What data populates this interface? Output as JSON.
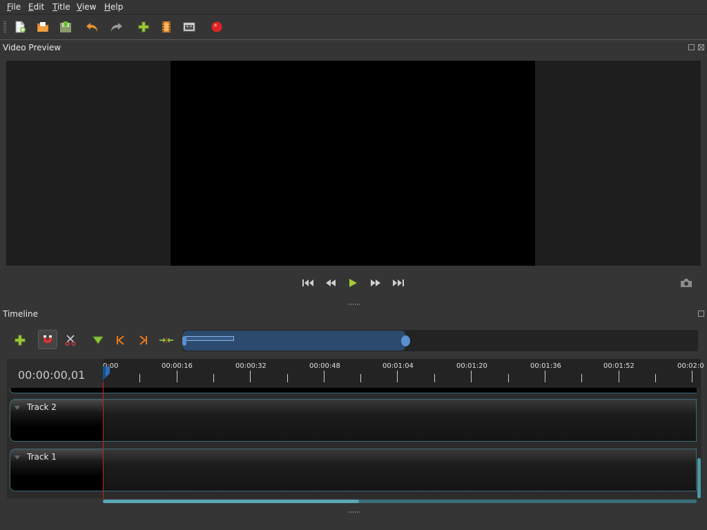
{
  "menu": [
    {
      "first": "F",
      "rest": "ile"
    },
    {
      "first": "E",
      "rest": "dit"
    },
    {
      "first": "T",
      "rest": "itle"
    },
    {
      "first": "V",
      "rest": "iew"
    },
    {
      "first": "H",
      "rest": "elp"
    }
  ],
  "toolbar": {
    "icons": [
      "new-project-icon",
      "open-project-icon",
      "save-project-icon",
      "undo-icon",
      "redo-icon",
      "import-files-icon",
      "choose-profile-icon",
      "fullscreen-icon",
      "export-video-icon"
    ]
  },
  "video_preview": {
    "title": "Video Preview",
    "controls": [
      "jump-start-icon",
      "rewind-icon",
      "play-icon",
      "fast-forward-icon",
      "jump-end-icon"
    ],
    "snapshot_icon": "camera-icon"
  },
  "timeline": {
    "title": "Timeline",
    "toolbar_icons": [
      "add-track-icon",
      "snap-magnet-icon",
      "razor-icon",
      "add-marker-icon",
      "previous-marker-icon",
      "next-marker-icon",
      "center-playhead-icon"
    ],
    "timecode": "00:00:00,01",
    "ruler_labels": [
      "0:00",
      "00:00:16",
      "00:00:32",
      "00:00:48",
      "00:01:04",
      "00:01:20",
      "00:01:36",
      "00:01:52",
      "00:02:0"
    ],
    "tracks": [
      {
        "name": "Track 2"
      },
      {
        "name": "Track 1"
      }
    ]
  },
  "colors": {
    "accent": "#5b8fd0",
    "track_border": "#3d6b78",
    "playhead": "#cc2222",
    "play_button": "#a6c93a",
    "record": "#e02424"
  }
}
